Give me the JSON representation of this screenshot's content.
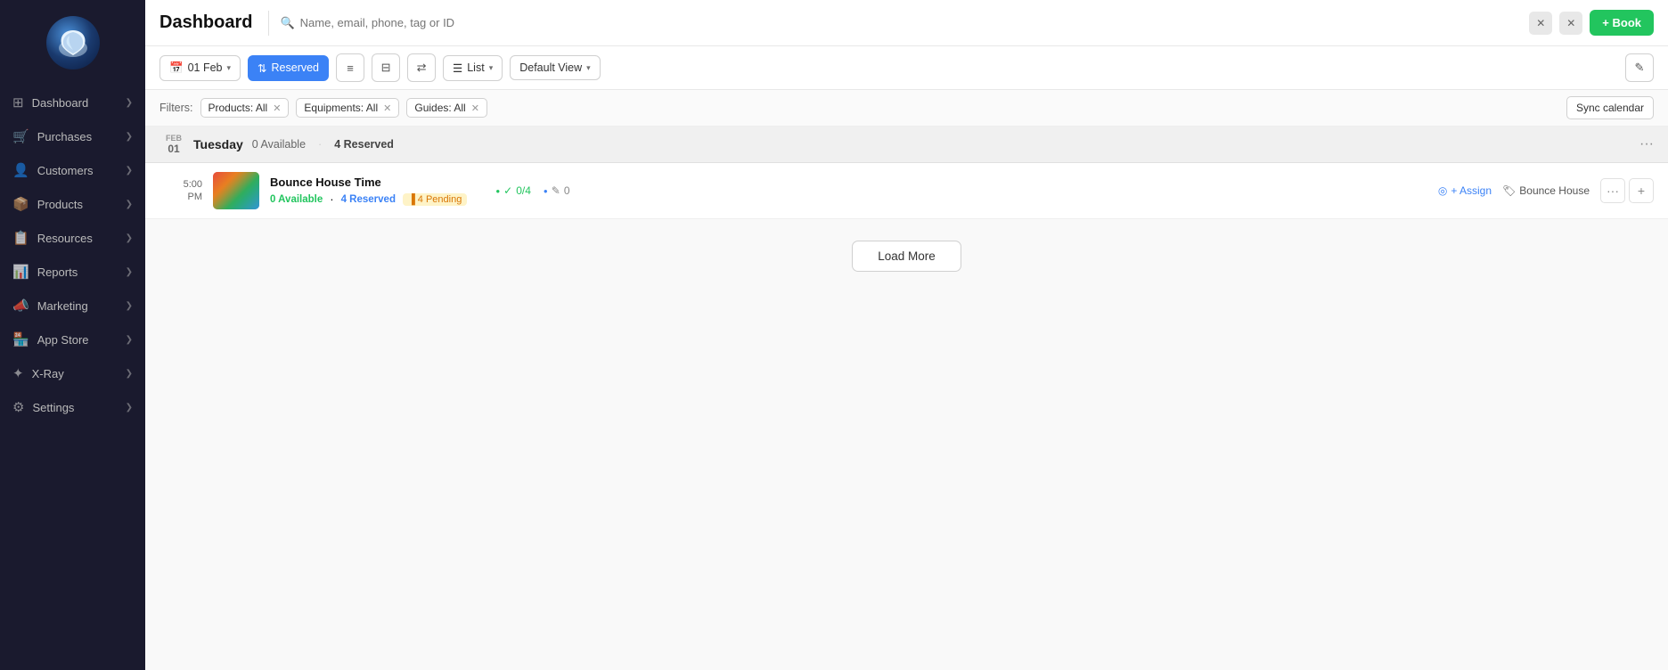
{
  "sidebar": {
    "items": [
      {
        "id": "dashboard",
        "label": "Dashboard",
        "icon": "⊞"
      },
      {
        "id": "purchases",
        "label": "Purchases",
        "icon": "🛒"
      },
      {
        "id": "customers",
        "label": "Customers",
        "icon": "👤"
      },
      {
        "id": "products",
        "label": "Products",
        "icon": "📦"
      },
      {
        "id": "resources",
        "label": "Resources",
        "icon": "📋"
      },
      {
        "id": "reports",
        "label": "Reports",
        "icon": "📊"
      },
      {
        "id": "marketing",
        "label": "Marketing",
        "icon": "📣"
      },
      {
        "id": "app-store",
        "label": "App Store",
        "icon": "🏪"
      },
      {
        "id": "x-ray",
        "label": "X-Ray",
        "icon": "✦"
      },
      {
        "id": "settings",
        "label": "Settings",
        "icon": "⚙"
      }
    ]
  },
  "header": {
    "title": "Dashboard",
    "search_placeholder": "Name, email, phone, tag or ID",
    "book_label": "+ Book"
  },
  "toolbar": {
    "date_label": "01 Feb",
    "reserved_label": "Reserved",
    "list_label": "List",
    "view_label": "Default View"
  },
  "filters": {
    "label": "Filters:",
    "products_filter": "Products: All",
    "equipments_filter": "Equipments: All",
    "guides_filter": "Guides: All",
    "sync_label": "Sync calendar"
  },
  "day": {
    "date_num": "01",
    "month": "Feb",
    "day_name": "Tuesday",
    "available_count": "0",
    "available_label": "Available",
    "reserved_count": "4",
    "reserved_label": "Reserved"
  },
  "booking": {
    "time_top": "5:00",
    "time_bottom": "PM",
    "title": "Bounce House Time",
    "available": "0 Available",
    "reserved": "4 Reserved",
    "pending_icon": "▐",
    "pending_label": "4 Pending",
    "check_count": "0/4",
    "edit_count": "0",
    "assign_label": "+ Assign",
    "tag_label": "Bounce House"
  },
  "load_more": {
    "label": "Load More"
  }
}
